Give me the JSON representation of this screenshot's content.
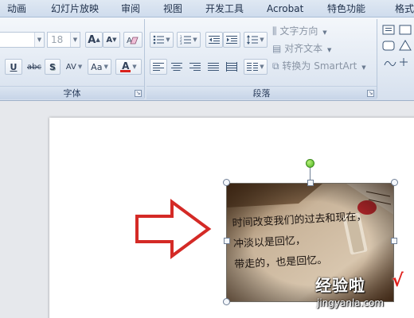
{
  "ribbon_tabs": [
    "动画",
    "幻灯片放映",
    "审阅",
    "视图",
    "开发工具",
    "Acrobat",
    "特色功能",
    "格式"
  ],
  "font_group": {
    "label": "字体",
    "font_size": "18",
    "grow_label": "A",
    "shrink_label": "A",
    "underline_label": "U",
    "strike_label": "abc",
    "shadow_label": "S",
    "spacing_label": "AV",
    "case_label": "Aa",
    "color_label": "A",
    "accent_color": "#d9221c"
  },
  "paragraph_group": {
    "label": "段落",
    "text_direction": "文字方向",
    "align_text": "对齐文本",
    "convert_smartart": "转换为 SmartArt"
  },
  "slide": {
    "photo_text": [
      "时间改变我们的过去和现在，",
      "冲淡以是回忆，",
      "带走的，也是回忆。"
    ]
  },
  "watermark": {
    "main": "经验啦",
    "check": "√",
    "url": "jingyanla.com"
  }
}
